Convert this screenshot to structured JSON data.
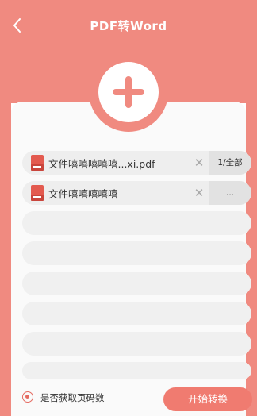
{
  "header": {
    "title": "PDF转Word"
  },
  "files": [
    {
      "name": "文件嘻嘻嘻嘻嘻...xi.pdf",
      "pages": "1/全部"
    },
    {
      "name": "文件嘻嘻嘻嘻嘻",
      "pages": "..."
    }
  ],
  "footer": {
    "checkbox_label": "是否获取页码数",
    "start_label": "开始转换"
  },
  "icons": {
    "back": "chevron-left-icon",
    "add": "plus-icon",
    "file": "pdf-file-icon",
    "remove": "close-icon",
    "check": "radio-checked-icon"
  },
  "colors": {
    "accent": "#f08a80",
    "button": "#f07b70"
  }
}
